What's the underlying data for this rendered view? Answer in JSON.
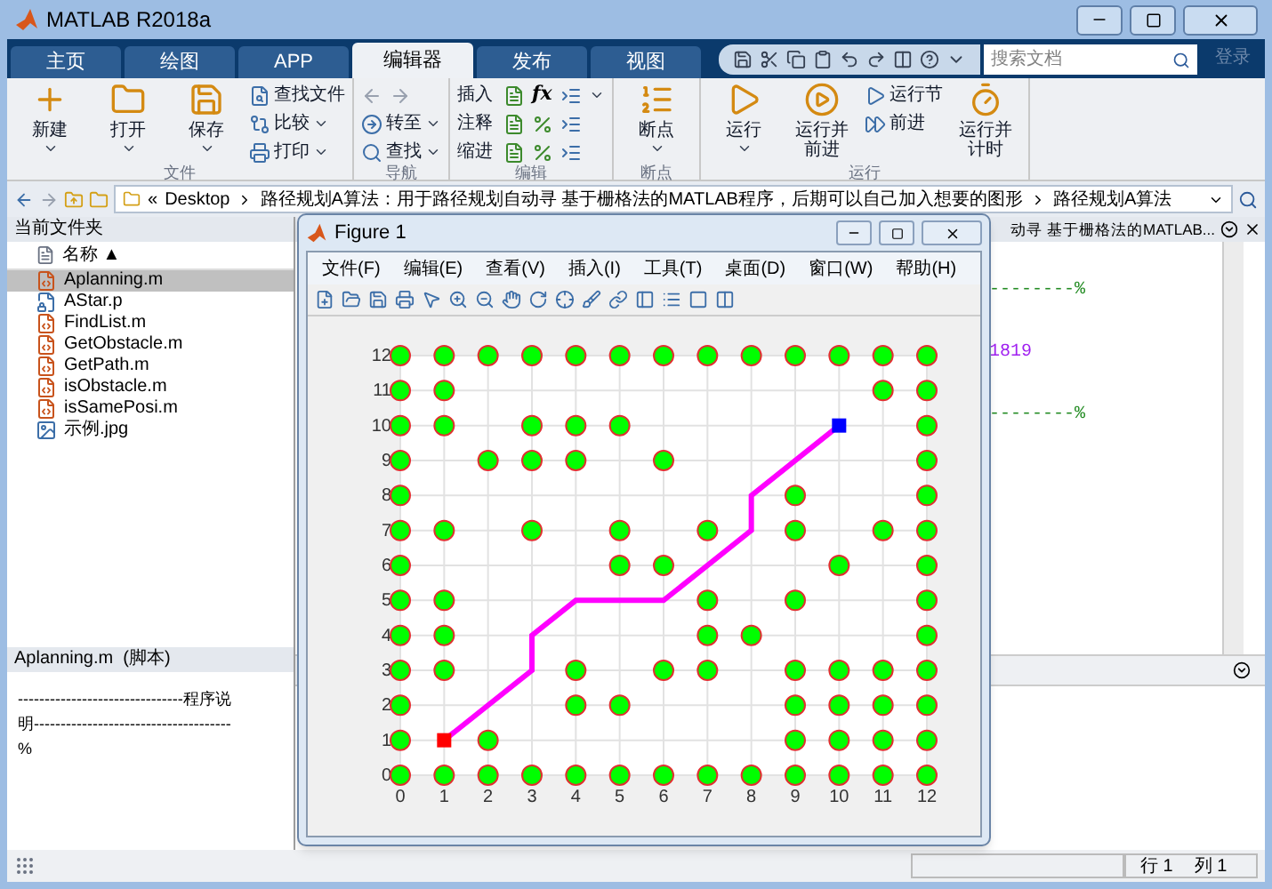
{
  "window": {
    "title": "MATLAB R2018a"
  },
  "tabs": [
    {
      "label": "主页",
      "selected": false
    },
    {
      "label": "绘图",
      "selected": false
    },
    {
      "label": "APP",
      "selected": false
    },
    {
      "label": "编辑器",
      "selected": true
    },
    {
      "label": "发布",
      "selected": false
    },
    {
      "label": "视图",
      "selected": false
    }
  ],
  "search": {
    "placeholder": "搜索文档"
  },
  "sign_in": "登录",
  "toolstrip": [
    {
      "label": "文件",
      "items": [
        {
          "kind": "large",
          "label": "新建",
          "dropdown": true
        },
        {
          "kind": "large",
          "label": "打开",
          "dropdown": true
        },
        {
          "kind": "large",
          "label": "保存",
          "dropdown": true
        },
        {
          "kind": "small",
          "label": "查找文件",
          "dropdown": false
        },
        {
          "kind": "small",
          "label": "比较",
          "dropdown": true
        },
        {
          "kind": "small",
          "label": "打印",
          "dropdown": true
        }
      ]
    },
    {
      "label": "导航",
      "items": [
        {
          "kind": "nav",
          "dropdown": false
        },
        {
          "kind": "small",
          "label": "转至",
          "dropdown": true
        },
        {
          "kind": "small",
          "label": "查找",
          "dropdown": true
        }
      ]
    },
    {
      "label": "编辑",
      "items": [
        {
          "kind": "edit",
          "label": "插入",
          "symbol": "fx",
          "dropdown": true
        },
        {
          "kind": "edit",
          "label": "注释",
          "dropdown": false
        },
        {
          "kind": "edit",
          "label": "缩进",
          "dropdown": false
        }
      ]
    },
    {
      "label": "断点",
      "items": [
        {
          "kind": "large",
          "label": "断点",
          "dropdown": true
        }
      ]
    },
    {
      "label": "运行",
      "items": [
        {
          "kind": "large",
          "label": "运行",
          "dropdown": true
        },
        {
          "kind": "large",
          "label": "运行并前进",
          "dropdown": false
        },
        {
          "kind": "small",
          "label": "运行节",
          "dropdown": false
        },
        {
          "kind": "small",
          "label": "前进",
          "dropdown": false
        },
        {
          "kind": "large",
          "label": "运行并计时",
          "dropdown": false
        }
      ]
    }
  ],
  "address_bar": {
    "overflow": "«",
    "crumbs": [
      "Desktop",
      "路径规划A算法：用于路径规划自动寻 基于栅格法的MATLAB程序，后期可以自己加入想要的图形",
      "路径规划A算法"
    ]
  },
  "current_folder": {
    "title": "当前文件夹",
    "column": "名称 ▲",
    "files": [
      {
        "name": "Aplanning.m",
        "kind": "script",
        "selected": true
      },
      {
        "name": "AStar.p",
        "kind": "protected",
        "selected": false
      },
      {
        "name": "FindList.m",
        "kind": "script",
        "selected": false
      },
      {
        "name": "GetObstacle.m",
        "kind": "script",
        "selected": false
      },
      {
        "name": "GetPath.m",
        "kind": "script",
        "selected": false
      },
      {
        "name": "isObstacle.m",
        "kind": "script",
        "selected": false
      },
      {
        "name": "isSamePosi.m",
        "kind": "script",
        "selected": false
      },
      {
        "name": "示例.jpg",
        "kind": "image",
        "selected": false
      }
    ]
  },
  "details": {
    "title": "Aplanning.m  (脚本)",
    "text": "-------------------------------程序说明-------------------------------------%"
  },
  "editor": {
    "tab": "动寻 基于栅格法的MATLAB...",
    "lines": [
      {
        "kind": "comment",
        "text": "--------%"
      },
      {
        "kind": "number",
        "text": "1819"
      },
      {
        "kind": "comment",
        "text": "--------%"
      }
    ]
  },
  "status_bar": {
    "row_label": "行",
    "row": "1",
    "col_label": "列",
    "col": "1"
  },
  "figure": {
    "title": "Figure 1",
    "menus": [
      "文件(F)",
      "编辑(E)",
      "查看(V)",
      "插入(I)",
      "工具(T)",
      "桌面(D)",
      "窗口(W)",
      "帮助(H)"
    ],
    "chart_data": {
      "type": "scatter",
      "grid": true,
      "xlim": [
        0,
        12
      ],
      "ylim": [
        0,
        12
      ],
      "xticks": [
        0,
        1,
        2,
        3,
        4,
        5,
        6,
        7,
        8,
        9,
        10,
        11,
        12
      ],
      "yticks": [
        0,
        1,
        2,
        3,
        4,
        5,
        6,
        7,
        8,
        9,
        10,
        11,
        12
      ],
      "series": [
        {
          "color": "#00ff00",
          "x": [
            0,
            1,
            2,
            3,
            4,
            5,
            6,
            7,
            8,
            9,
            10,
            11,
            12,
            0,
            2,
            9,
            10,
            11,
            12,
            0,
            4,
            5,
            9,
            10,
            11,
            12,
            0,
            1,
            4,
            6,
            7,
            9,
            10,
            11,
            12,
            0,
            1,
            7,
            8,
            12,
            0,
            1,
            7,
            9,
            12,
            0,
            5,
            6,
            10,
            12,
            0,
            1,
            3,
            5,
            7,
            9,
            11,
            12,
            0,
            9,
            12,
            0,
            2,
            3,
            4,
            6,
            12,
            0,
            1,
            3,
            4,
            5,
            12,
            0,
            1,
            11,
            12,
            0,
            1,
            2,
            3,
            4,
            5,
            6,
            7,
            8,
            9,
            10,
            11,
            12
          ],
          "values": [
            0,
            0,
            0,
            0,
            0,
            0,
            0,
            0,
            0,
            0,
            0,
            0,
            0,
            1,
            1,
            1,
            1,
            1,
            1,
            2,
            2,
            2,
            2,
            2,
            2,
            2,
            3,
            3,
            3,
            3,
            3,
            3,
            3,
            3,
            3,
            4,
            4,
            4,
            4,
            4,
            5,
            5,
            5,
            5,
            5,
            6,
            6,
            6,
            6,
            6,
            7,
            7,
            7,
            7,
            7,
            7,
            7,
            7,
            8,
            8,
            8,
            9,
            9,
            9,
            9,
            9,
            9,
            10,
            10,
            10,
            10,
            10,
            10,
            11,
            11,
            11,
            11,
            12,
            12,
            12,
            12,
            12,
            12,
            12,
            12,
            12,
            12,
            12,
            12,
            12
          ]
        },
        {
          "type": "line",
          "color": "#ff00ff",
          "x": [
            1,
            3,
            3,
            4,
            6,
            8,
            8,
            10
          ],
          "values": [
            1,
            3,
            4,
            5,
            5,
            7,
            8,
            10
          ]
        },
        {
          "color": "#ff0000",
          "x": [
            1
          ],
          "values": [
            1
          ]
        },
        {
          "color": "#0000ff",
          "x": [
            10
          ],
          "values": [
            10
          ]
        }
      ]
    }
  }
}
